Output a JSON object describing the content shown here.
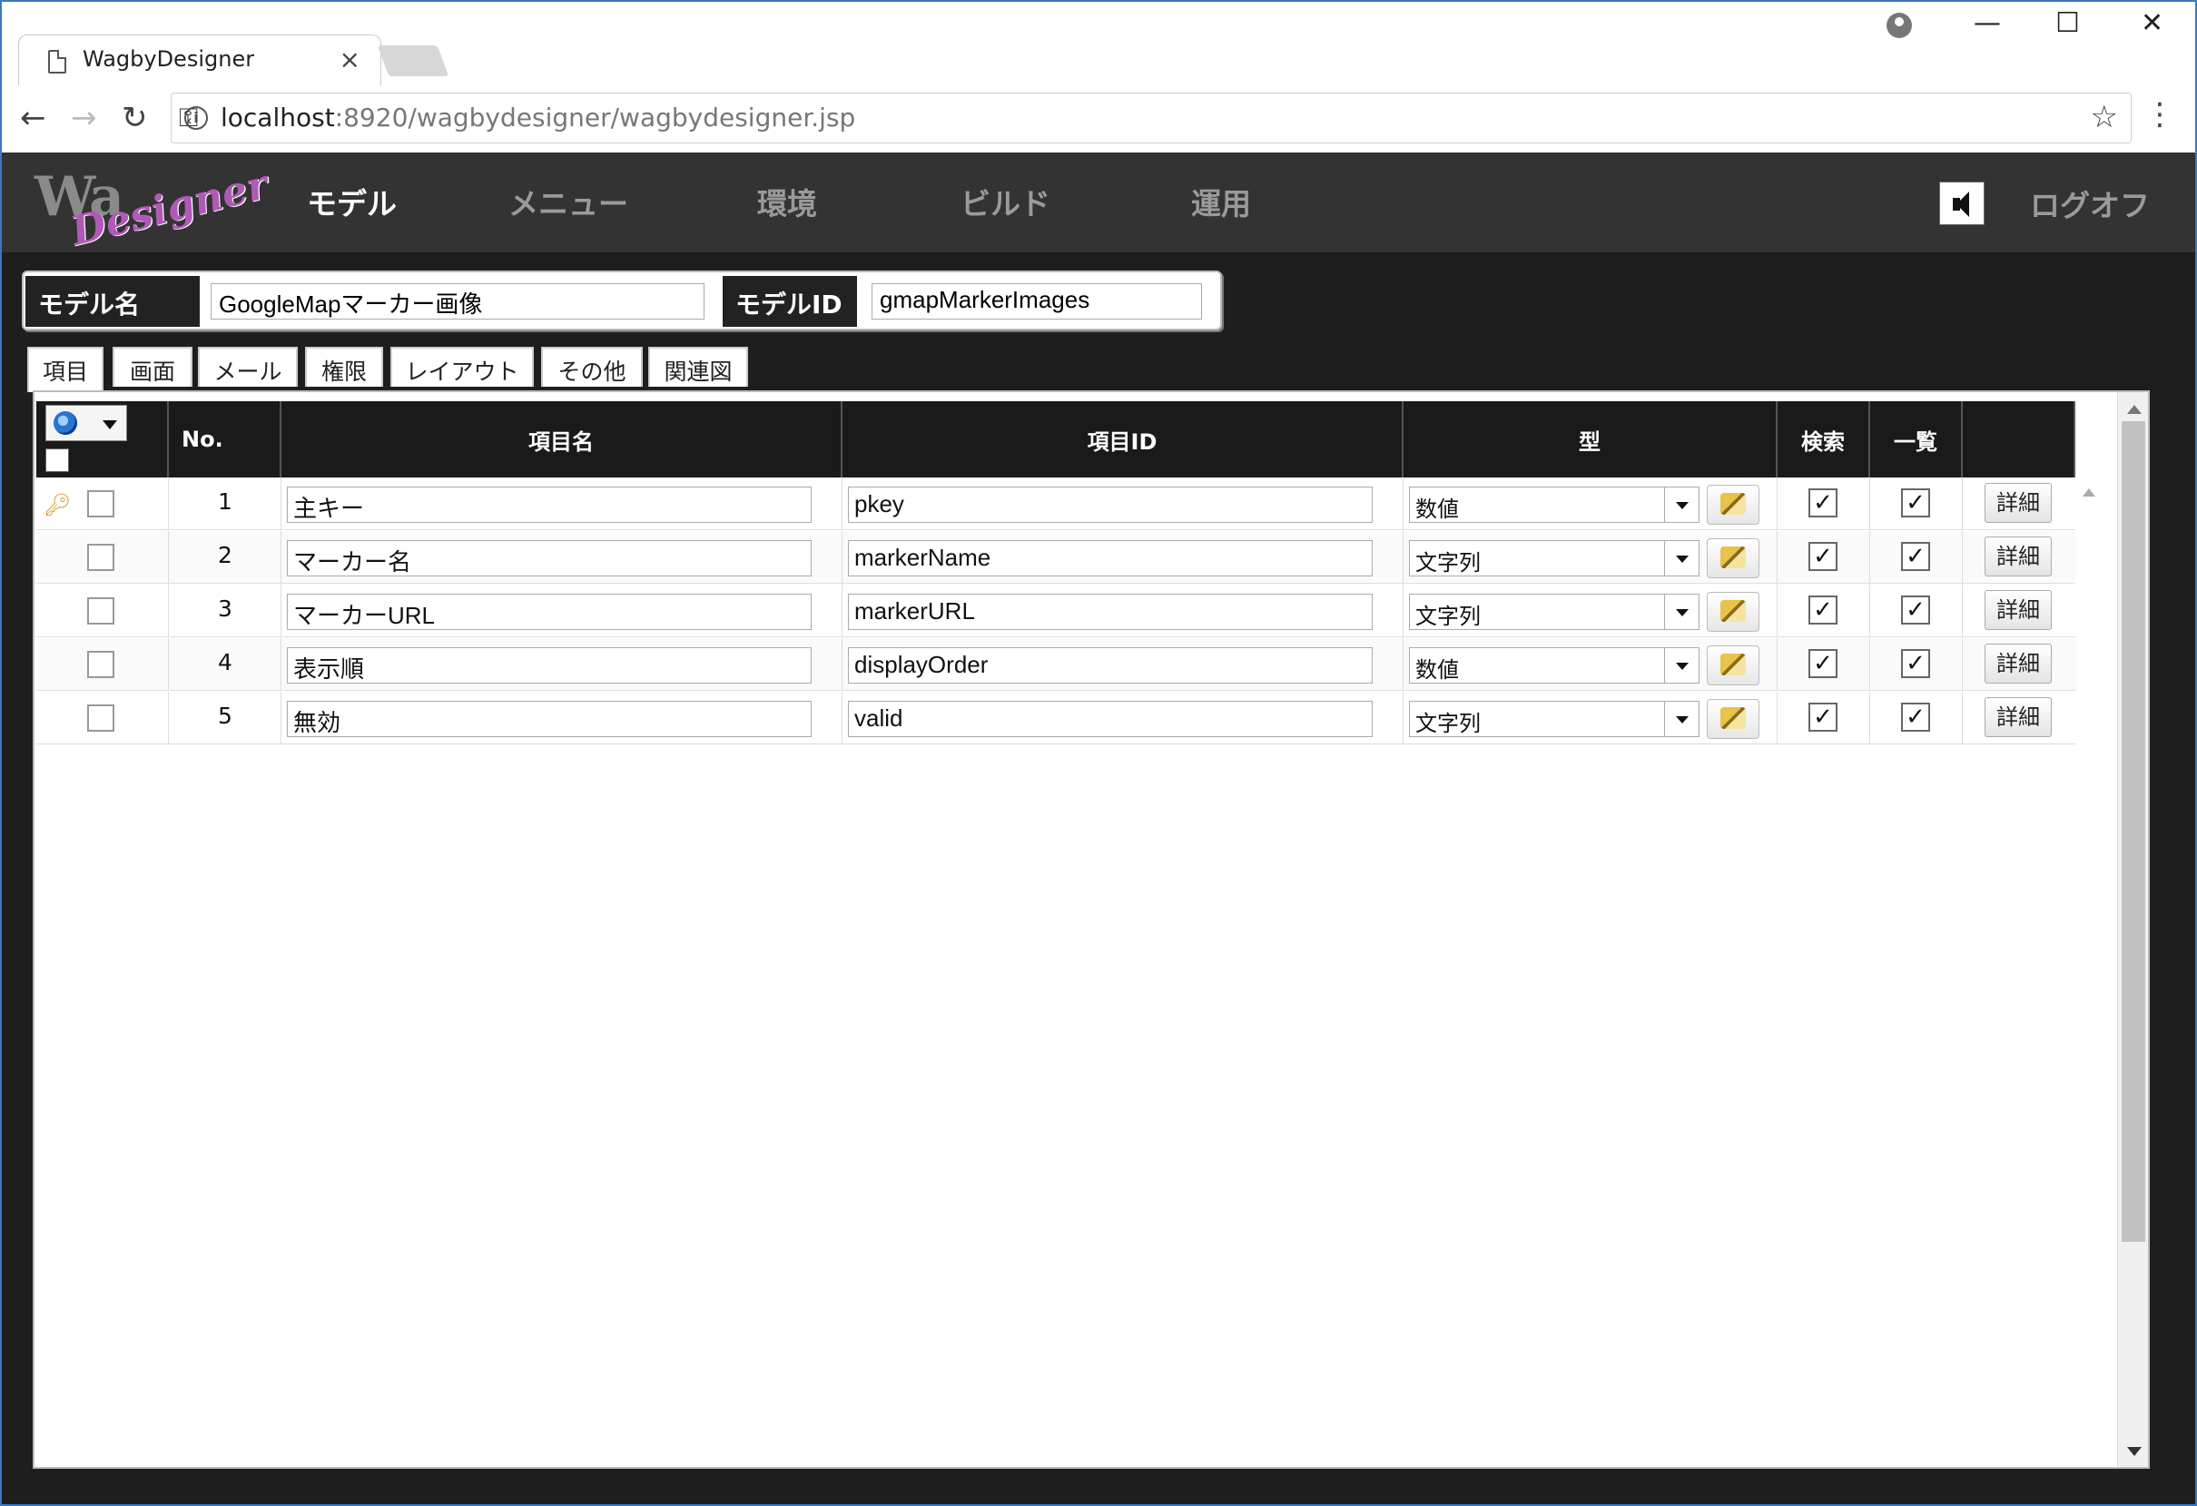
{
  "browser": {
    "tab_title": "WagbyDesigner",
    "tab_close": "×",
    "url_host": "localhost",
    "url_path": ":8920/wagbydesigner/wagbydesigner.jsp",
    "window_controls": [
      "—",
      "☐",
      "✕"
    ]
  },
  "header": {
    "logo_text": "Wa",
    "logo_sub": "Designer",
    "nav": [
      "モデル",
      "メニュー",
      "環境",
      "ビルド",
      "運用"
    ],
    "active_nav": "モデル",
    "logoff": "ログオフ"
  },
  "model": {
    "name_label": "モデル名",
    "name_value": "GoogleMapマーカー画像",
    "id_label": "モデルID",
    "id_value": "gmapMarkerImages"
  },
  "subtabs": [
    "項目",
    "画面",
    "メール",
    "権限",
    "レイアウト",
    "その他",
    "関連図"
  ],
  "grid": {
    "headers": {
      "no": "No.",
      "name": "項目名",
      "id": "項目ID",
      "type": "型",
      "search": "検索",
      "list": "一覧"
    },
    "detail_label": "詳細",
    "rows": [
      {
        "no": "1",
        "name": "主キー",
        "id": "pkey",
        "type": "数値",
        "key": true,
        "search": true,
        "list": true
      },
      {
        "no": "2",
        "name": "マーカー名",
        "id": "markerName",
        "type": "文字列",
        "key": false,
        "search": true,
        "list": true
      },
      {
        "no": "3",
        "name": "マーカーURL",
        "id": "markerURL",
        "type": "文字列",
        "key": false,
        "search": true,
        "list": true
      },
      {
        "no": "4",
        "name": "表示順",
        "id": "displayOrder",
        "type": "数値",
        "key": false,
        "search": true,
        "list": true
      },
      {
        "no": "5",
        "name": "無効",
        "id": "valid",
        "type": "文字列",
        "key": false,
        "search": true,
        "list": true
      }
    ]
  },
  "colors": {
    "app_bg": "#1e1e1e",
    "header_bg": "#333333",
    "grid_header_bg": "#1a1a1a",
    "accent_logo": "#b05ab8",
    "key_icon": "#d89a20"
  }
}
